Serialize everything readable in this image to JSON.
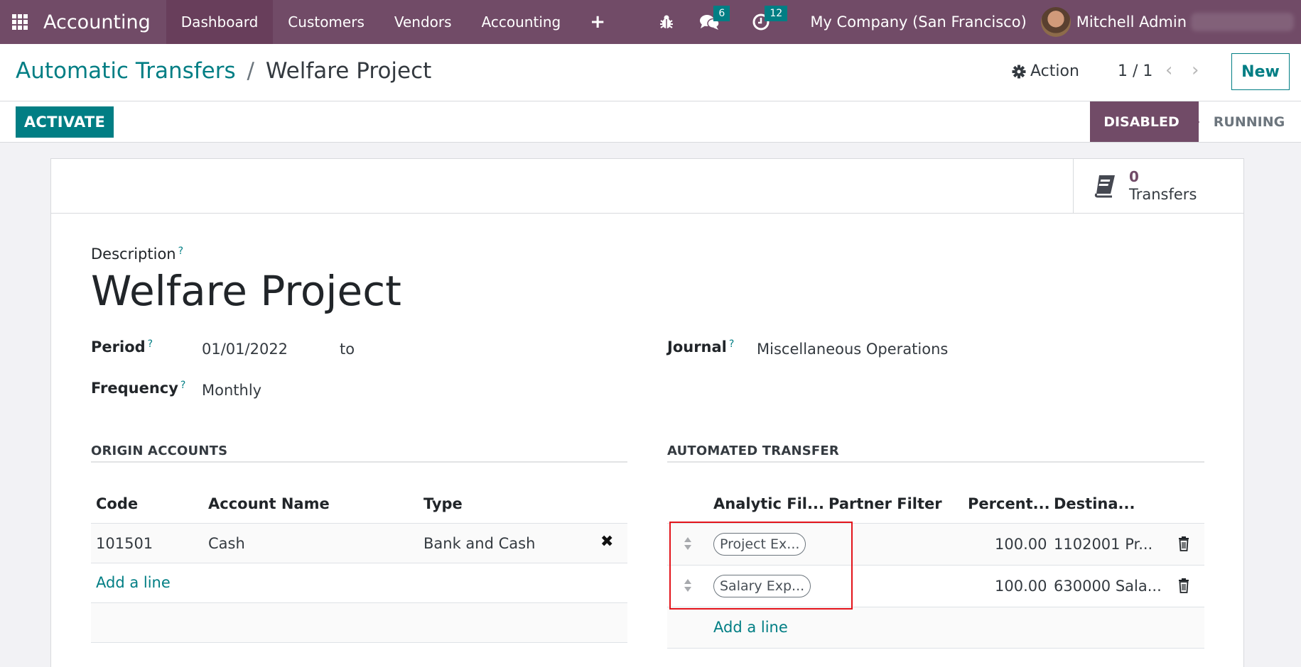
{
  "navbar": {
    "app_name": "Accounting",
    "menu": [
      "Dashboard",
      "Customers",
      "Vendors",
      "Accounting"
    ],
    "active_menu": "Dashboard",
    "messages_count": "6",
    "activities_count": "12",
    "company": "My Company (San Francisco)",
    "user": "Mitchell Admin"
  },
  "breadcrumb": {
    "parent": "Automatic Transfers",
    "separator": "/",
    "current": "Welfare Project"
  },
  "control": {
    "action_label": "Action",
    "pager": "1 / 1",
    "new_label": "New"
  },
  "statusbar": {
    "activate_label": "ACTIVATE",
    "stages": [
      "DISABLED",
      "RUNNING"
    ],
    "current_stage": "DISABLED"
  },
  "stat_button": {
    "value": "0",
    "label": "Transfers"
  },
  "form": {
    "description_label": "Description",
    "description": "Welfare Project",
    "period_label": "Period",
    "period_start": "01/01/2022",
    "period_to": "to",
    "period_end": "",
    "frequency_label": "Frequency",
    "frequency": "Monthly",
    "journal_label": "Journal",
    "journal": "Miscellaneous Operations",
    "help_mark": "?"
  },
  "origin_accounts": {
    "title": "ORIGIN ACCOUNTS",
    "columns": [
      "Code",
      "Account Name",
      "Type"
    ],
    "rows": [
      {
        "code": "101501",
        "name": "Cash",
        "type": "Bank and Cash"
      }
    ],
    "add_line": "Add a line"
  },
  "automated_transfer": {
    "title": "AUTOMATED TRANSFER",
    "columns": [
      "Analytic Fil...",
      "Partner Filter",
      "Percent...",
      "Destina..."
    ],
    "rows": [
      {
        "analytic": "Project Ex...",
        "partner": "",
        "percent": "100.00",
        "destination": "1102001 Pr..."
      },
      {
        "analytic": "Salary Exp...",
        "partner": "",
        "percent": "100.00",
        "destination": "630000 Sala..."
      }
    ],
    "add_line": "Add a line"
  },
  "colors": {
    "brand": "#714b67",
    "accent": "#017e84",
    "highlight": "#e3141b"
  }
}
